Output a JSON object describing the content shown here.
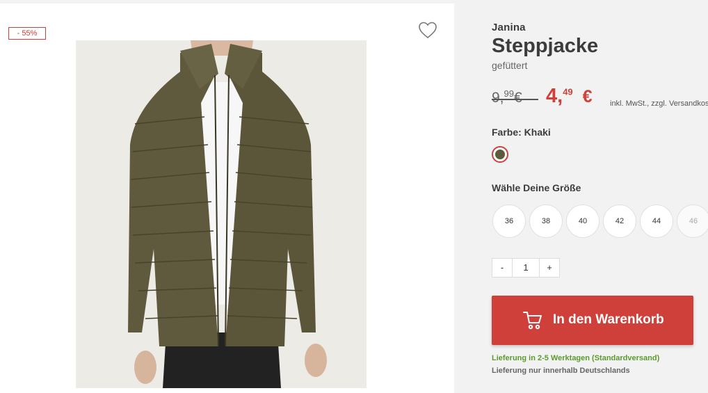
{
  "gallery": {
    "discount_badge": "- 55%",
    "wishlist_icon": "heart-icon",
    "image_alt": "jacket-photo"
  },
  "product": {
    "brand": "Janina",
    "title": "Steppjacke",
    "subtitle": "gefüttert",
    "old_price_main": "9,",
    "old_price_cents": "99",
    "old_price_currency": "€",
    "new_price_main": "4,",
    "new_price_cents": "49",
    "new_price_currency": "€",
    "tax_note": "inkl. MwSt., zzgl. Versandkosten",
    "color_label": "Farbe: Khaki",
    "swatch_color": "#5e5a3c",
    "size_label": "Wähle Deine Größe",
    "sizes": [
      "36",
      "38",
      "40",
      "42",
      "44",
      "46"
    ],
    "unavailable_size": "46"
  },
  "quantity": {
    "minus": "-",
    "value": "1",
    "plus": "+"
  },
  "cart": {
    "label": "In den Warenkorb",
    "icon": "cart-icon"
  },
  "shipping": {
    "delivery": "Lieferung in 2-5 Werktagen (Standardversand)",
    "region": "Lieferung nur innerhalb Deutschlands"
  },
  "colors": {
    "accent": "#d0403a",
    "success": "#5a9a2e"
  }
}
